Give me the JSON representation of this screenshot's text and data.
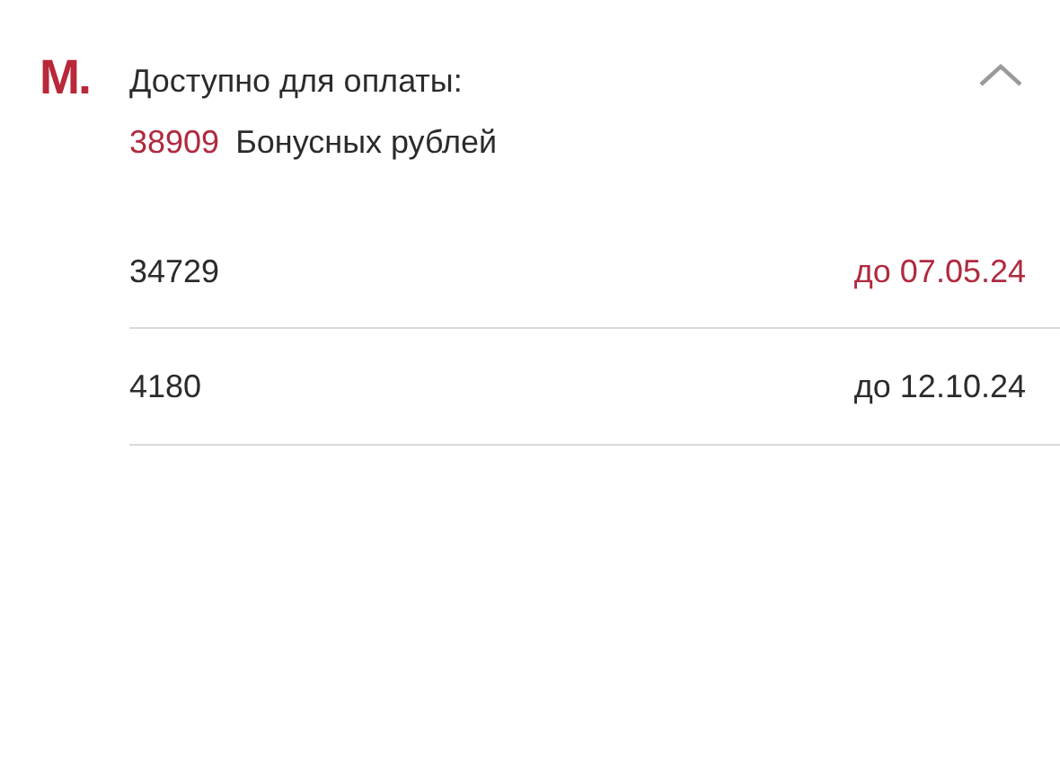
{
  "logo": "M.",
  "header": {
    "title": "Доступно для оплаты:",
    "amount": "38909",
    "unit": "Бонусных рублей",
    "expanded": true
  },
  "rows": [
    {
      "amount": "34729",
      "expiry": "до 07.05.24",
      "urgent": true
    },
    {
      "amount": "4180",
      "expiry": "до 12.10.24",
      "urgent": false
    }
  ]
}
